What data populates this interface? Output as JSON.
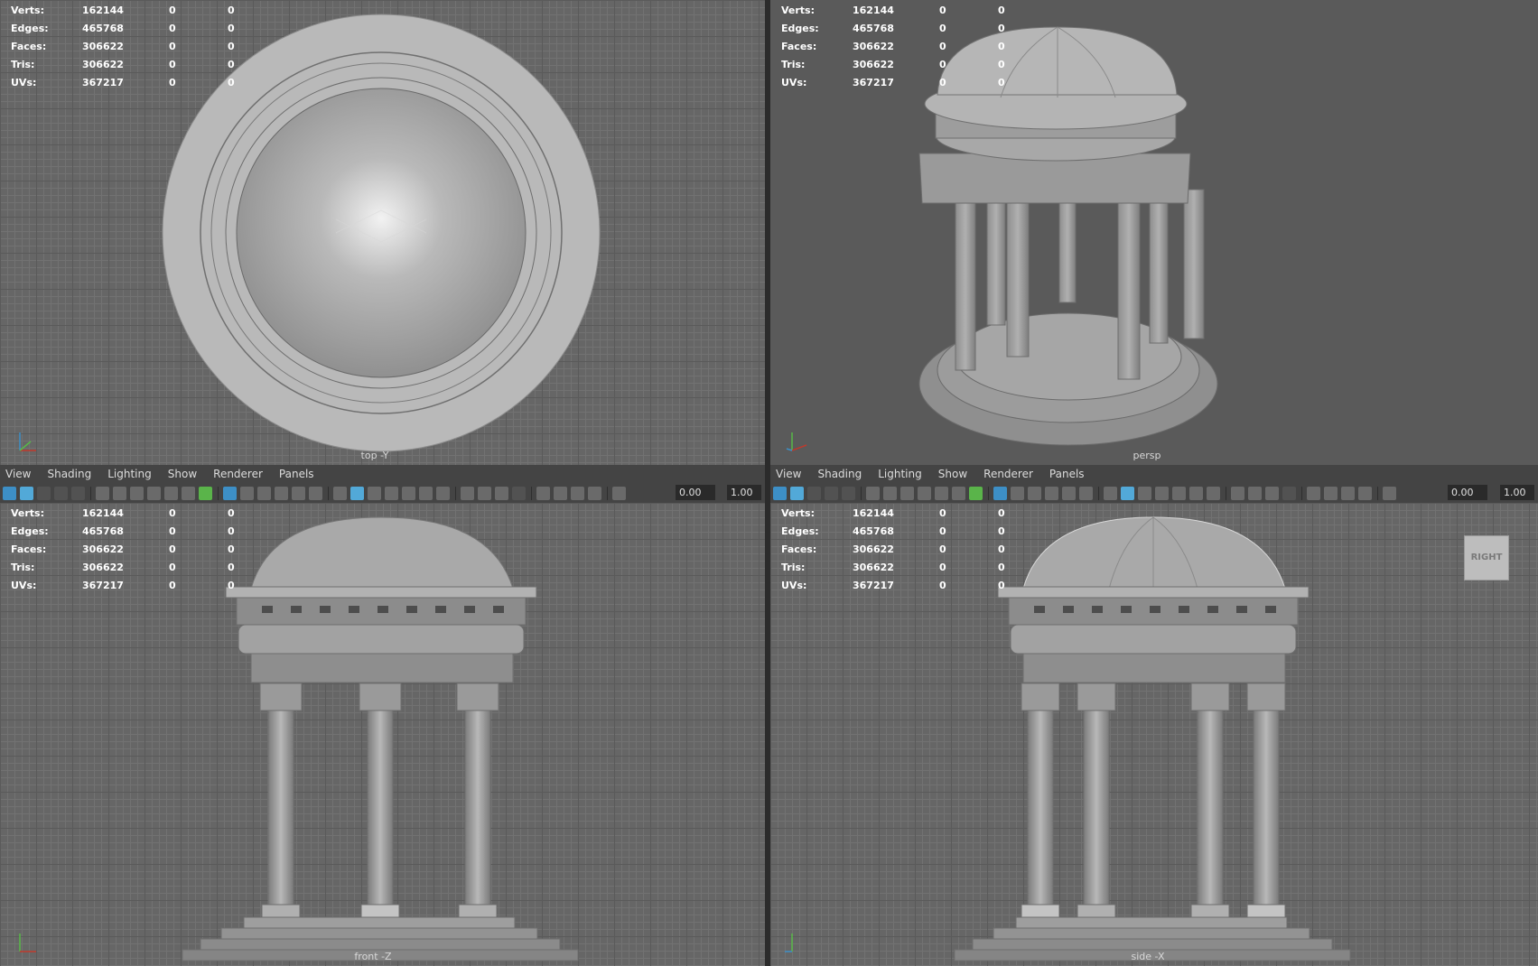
{
  "stats": [
    {
      "label": "Verts:",
      "value": "162144",
      "sel_a": "0",
      "sel_b": "0"
    },
    {
      "label": "Edges:",
      "value": "465768",
      "sel_a": "0",
      "sel_b": "0"
    },
    {
      "label": "Faces:",
      "value": "306622",
      "sel_a": "0",
      "sel_b": "0"
    },
    {
      "label": "Tris:",
      "value": "306622",
      "sel_a": "0",
      "sel_b": "0"
    },
    {
      "label": "UVs:",
      "value": "367217",
      "sel_a": "0",
      "sel_b": "0"
    }
  ],
  "viewports": {
    "top": {
      "camera": "top -Y"
    },
    "persp": {
      "camera": "persp"
    },
    "front": {
      "camera": "front -Z"
    },
    "side": {
      "camera": "side -X"
    }
  },
  "panel_menu": [
    "View",
    "Shading",
    "Lighting",
    "Show",
    "Renderer",
    "Panels"
  ],
  "toolbar": {
    "field_a": "0.00",
    "field_b": "1.00"
  },
  "viewcube": {
    "label": "RIGHT"
  },
  "colors": {
    "grid_bg": "#666666",
    "panel_bar": "#444444",
    "accent": "#3d8fc6"
  },
  "icons": [
    "camera-icon",
    "grid-icon",
    "wireframe-icon",
    "smooth-shade-icon",
    "lights-icon",
    "isolate-icon"
  ]
}
